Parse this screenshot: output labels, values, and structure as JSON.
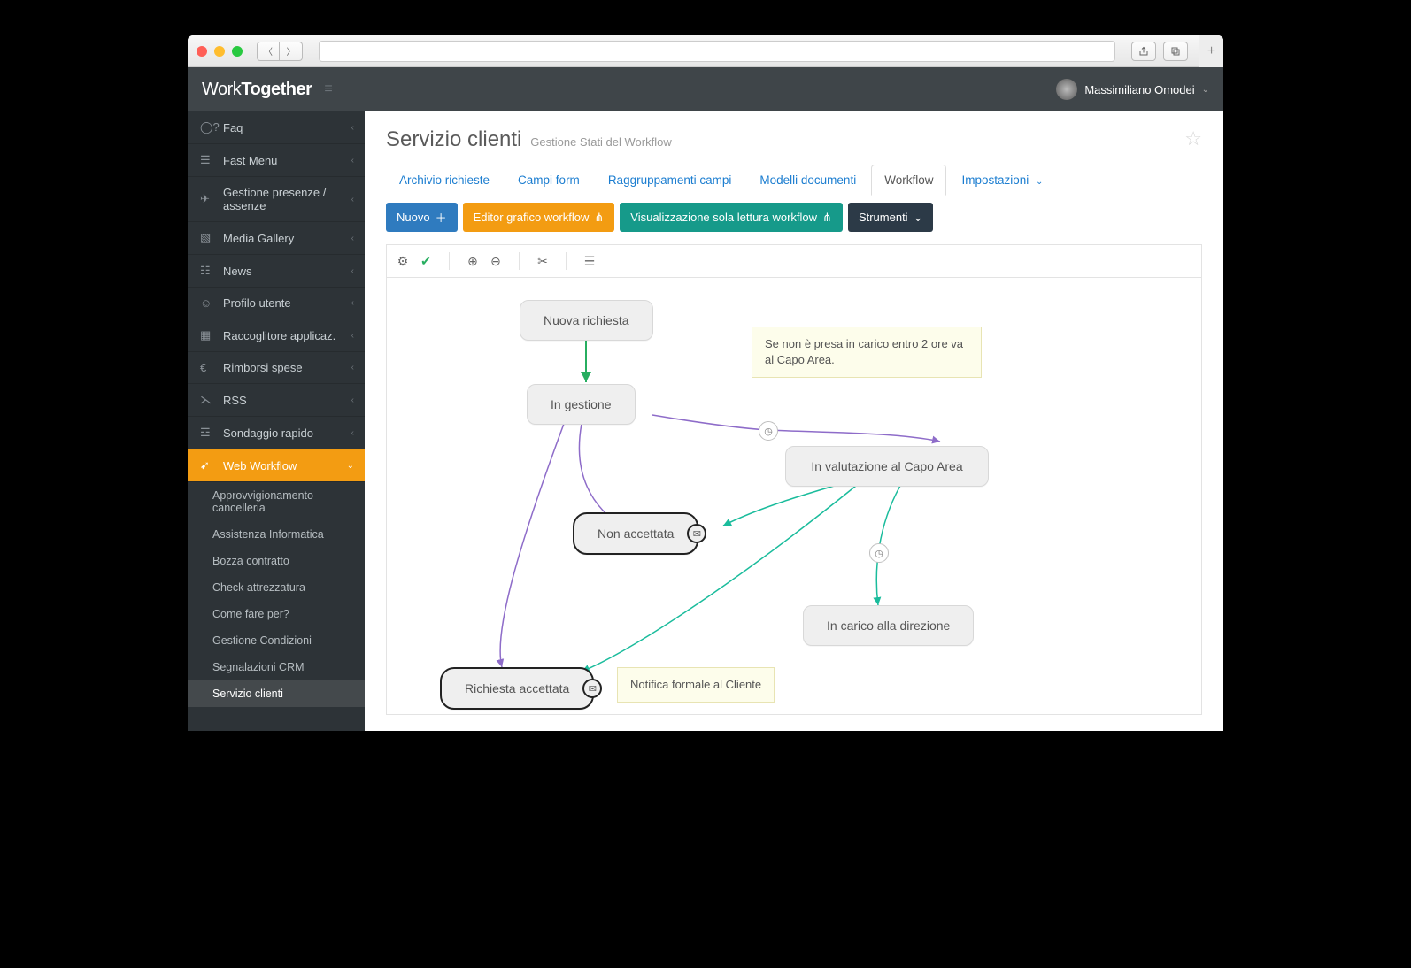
{
  "header": {
    "logo_light": "Work",
    "logo_bold": "Together",
    "user_name": "Massimiliano Omodei"
  },
  "sidebar": {
    "items": [
      {
        "label": "Faq",
        "icon": "?"
      },
      {
        "label": "Fast Menu",
        "icon": "list"
      },
      {
        "label": "Gestione presenze / assenze",
        "icon": "plane"
      },
      {
        "label": "Media Gallery",
        "icon": "image"
      },
      {
        "label": "News",
        "icon": "news"
      },
      {
        "label": "Profilo utente",
        "icon": "user"
      },
      {
        "label": "Raccoglitore applicaz.",
        "icon": "grid"
      },
      {
        "label": "Rimborsi spese",
        "icon": "euro"
      },
      {
        "label": "RSS",
        "icon": "rss"
      },
      {
        "label": "Sondaggio rapido",
        "icon": "bar"
      },
      {
        "label": "Web Workflow",
        "icon": "rocket"
      }
    ],
    "sub_items": [
      "Approvvigionamento cancelleria",
      "Assistenza Informatica",
      "Bozza contratto",
      "Check attrezzatura",
      "Come fare per?",
      "Gestione Condizioni",
      "Segnalazioni CRM",
      "Servizio clienti"
    ]
  },
  "page": {
    "title": "Servizio clienti",
    "subtitle": "Gestione Stati del Workflow"
  },
  "tabs": [
    {
      "label": "Archivio richieste"
    },
    {
      "label": "Campi form"
    },
    {
      "label": "Raggruppamenti campi"
    },
    {
      "label": "Modelli documenti"
    },
    {
      "label": "Workflow",
      "active": true
    },
    {
      "label": "Impostazioni",
      "caret": true
    }
  ],
  "actions": {
    "nuovo": "Nuovo",
    "editor": "Editor grafico workflow",
    "visual": "Visualizzazione sola lettura workflow",
    "strumenti": "Strumenti"
  },
  "nodes": {
    "nuova": "Nuova richiesta",
    "gestione": "In gestione",
    "valutazione": "In valutazione al Capo Area",
    "non_accettata": "Non accettata",
    "in_carico": "In carico alla direzione",
    "accettata": "Richiesta accettata"
  },
  "notes": {
    "note1": "Se non è presa in carico entro 2 ore va al Capo Area.",
    "note2": "Notifica formale al Cliente"
  }
}
